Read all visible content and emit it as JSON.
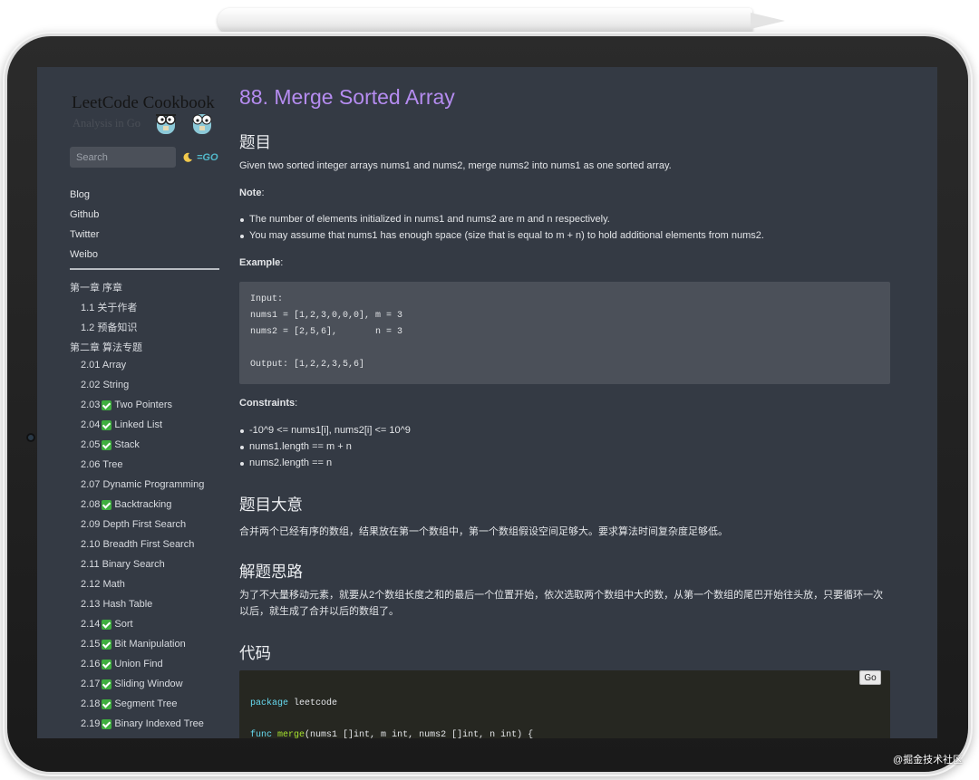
{
  "sidebar": {
    "logo_title": "LeetCode Cookbook",
    "logo_subtitle": "Analysis in Go",
    "search_placeholder": "Search",
    "go_logo": "=GO",
    "links": [
      "Blog",
      "Github",
      "Twitter",
      "Weibo"
    ],
    "toc": [
      {
        "label": "第一章 序章",
        "level": 0,
        "done": false
      },
      {
        "label": "1.1 关于作者",
        "level": 1,
        "done": false
      },
      {
        "label": "1.2 预备知识",
        "level": 1,
        "done": false
      },
      {
        "label": "第二章 算法专题",
        "level": 0,
        "done": false
      },
      {
        "label": "2.01 Array",
        "level": 1,
        "done": false
      },
      {
        "label": "2.02 String",
        "level": 1,
        "done": false
      },
      {
        "num": "2.03",
        "label": "Two Pointers",
        "level": 1,
        "done": true
      },
      {
        "num": "2.04",
        "label": "Linked List",
        "level": 1,
        "done": true
      },
      {
        "num": "2.05",
        "label": "Stack",
        "level": 1,
        "done": true
      },
      {
        "label": "2.06 Tree",
        "level": 1,
        "done": false
      },
      {
        "label": "2.07 Dynamic Programming",
        "level": 1,
        "done": false
      },
      {
        "num": "2.08",
        "label": "Backtracking",
        "level": 1,
        "done": true
      },
      {
        "label": "2.09 Depth First Search",
        "level": 1,
        "done": false
      },
      {
        "label": "2.10 Breadth First Search",
        "level": 1,
        "done": false
      },
      {
        "label": "2.11 Binary Search",
        "level": 1,
        "done": false
      },
      {
        "label": "2.12 Math",
        "level": 1,
        "done": false
      },
      {
        "label": "2.13 Hash Table",
        "level": 1,
        "done": false
      },
      {
        "num": "2.14",
        "label": "Sort",
        "level": 1,
        "done": true
      },
      {
        "num": "2.15",
        "label": "Bit Manipulation",
        "level": 1,
        "done": true
      },
      {
        "num": "2.16",
        "label": "Union Find",
        "level": 1,
        "done": true
      },
      {
        "num": "2.17",
        "label": "Sliding Window",
        "level": 1,
        "done": true
      },
      {
        "num": "2.18",
        "label": "Segment Tree",
        "level": 1,
        "done": true
      },
      {
        "num": "2.19",
        "label": "Binary Indexed Tree",
        "level": 1,
        "done": true
      }
    ]
  },
  "article": {
    "title": "88. Merge Sorted Array",
    "h_problem": "题目",
    "problem_text": "Given two sorted integer arrays nums1 and nums2, merge nums2 into nums1 as one sorted array.",
    "note_label": "Note",
    "notes": [
      "The number of elements initialized in nums1 and nums2 are m and n respectively.",
      "You may assume that nums1 has enough space (size that is equal to m + n) to hold additional elements from nums2."
    ],
    "example_label": "Example",
    "example_lines": [
      "Input:",
      "nums1 = [1,2,3,0,0,0], m = 3",
      "nums2 = [2,5,6],       n = 3",
      "",
      "Output: [1,2,2,3,5,6]"
    ],
    "constraints_label": "Constraints",
    "constraints": [
      "-10^9 <= nums1[i], nums2[i] <= 10^9",
      "nums1.length == m + n",
      "nums2.length == n"
    ],
    "h_meaning": "题目大意",
    "meaning_text": "合并两个已经有序的数组，结果放在第一个数组中，第一个数组假设空间足够大。要求算法时间复杂度足够低。",
    "h_approach": "解题思路",
    "approach_text": "为了不大量移动元素，就要从2个数组长度之和的最后一个位置开始，依次选取两个数组中大的数，从第一个数组的尾巴开始往头放，只要循环一次以后，就生成了合并以后的数组了。",
    "h_code": "代码",
    "go_button": "Go",
    "code_package_kw": "package",
    "code_package_name": "leetcode",
    "code_func_kw": "func",
    "code_func_name": "merge",
    "code_func_args": "(nums1 []int, m int, nums2 []int, n int) {"
  },
  "watermark": "@掘金技术社区"
}
